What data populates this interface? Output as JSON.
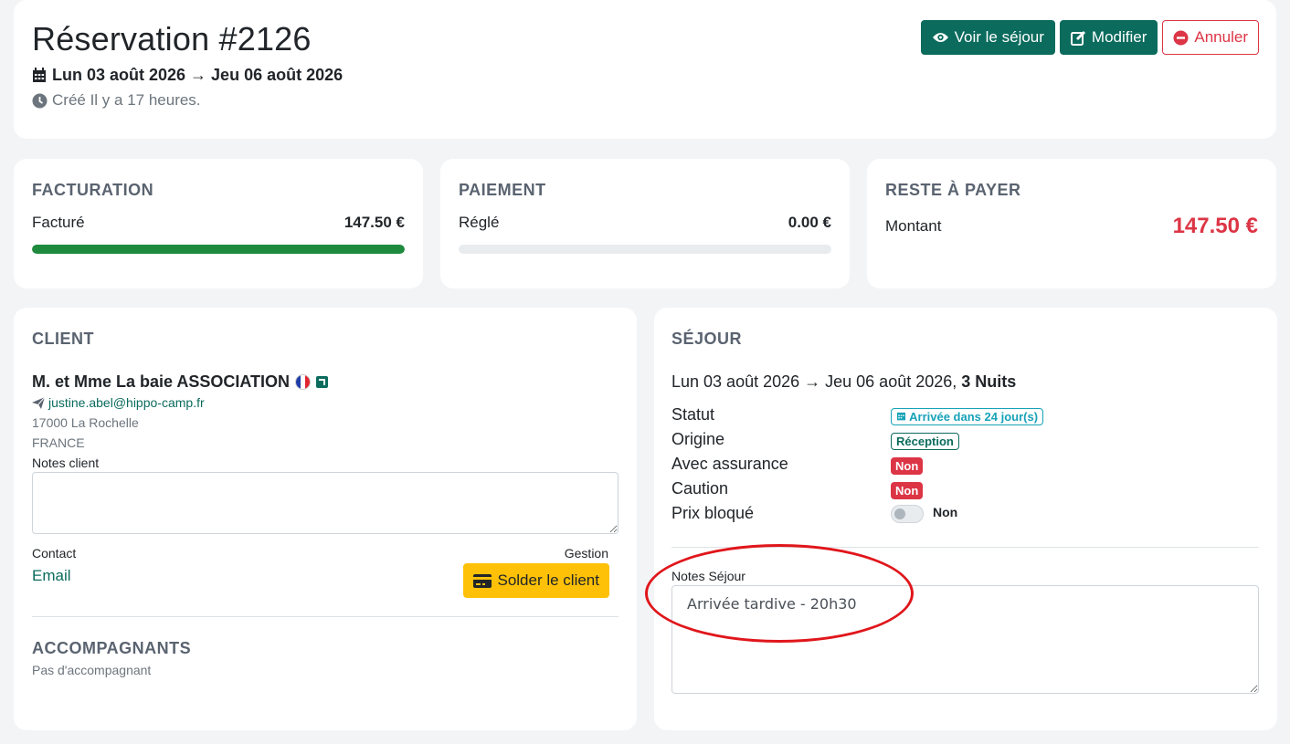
{
  "header": {
    "title": "Réservation #2126",
    "dates": "Lun 03 août 2026 → Jeu 06 août 2026",
    "created": "Créé Il y a 17 heures.",
    "actions": {
      "view_label": "Voir le séjour",
      "edit_label": "Modifier",
      "cancel_label": "Annuler"
    }
  },
  "billing": {
    "title": "FACTURATION",
    "label": "Facturé",
    "value": "147.50 €",
    "progress": 1.0
  },
  "payment": {
    "title": "PAIEMENT",
    "label": "Réglé",
    "value": "0.00 €",
    "progress": 0.0
  },
  "balance": {
    "title": "RESTE À PAYER",
    "label": "Montant",
    "value": "147.50 €"
  },
  "client": {
    "title": "CLIENT",
    "name": "M. et Mme La baie ASSOCIATION",
    "email": "justine.abel@hippo-camp.fr",
    "city": "17000 La Rochelle",
    "country": "FRANCE",
    "notes_label": "Notes client",
    "notes_value": "",
    "contact_label": "Contact",
    "contact_link": "Email",
    "gestion_label": "Gestion",
    "settle_button": "Solder le client"
  },
  "companions": {
    "title": "ACCOMPAGNANTS",
    "empty": "Pas d'accompagnant"
  },
  "stay": {
    "title": "SÉJOUR",
    "dates": "Lun 03 août 2026 → Jeu 06 août 2026,",
    "nights": "3 Nuits",
    "status_label": "Statut",
    "status_value": "Arrivée dans 24 jour(s)",
    "origin_label": "Origine",
    "origin_value": "Réception",
    "insurance_label": "Avec assurance",
    "insurance_value": "Non",
    "deposit_label": "Caution",
    "deposit_value": "Non",
    "price_lock_label": "Prix bloqué",
    "price_lock_value": "Non",
    "notes_label": "Notes Séjour",
    "notes_value": "Arrivée tardive - 20h30"
  },
  "colors": {
    "primary": "#0b6b5d",
    "danger": "#dc3545",
    "warning": "#ffc107",
    "info": "#17a2b8",
    "success": "#1e8a3e",
    "annotation": "#e0161b"
  }
}
